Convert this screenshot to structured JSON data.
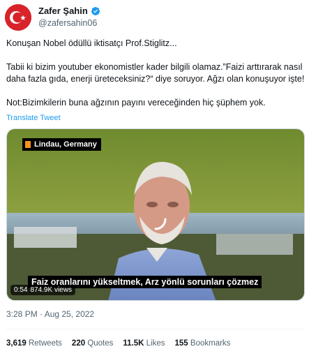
{
  "author": {
    "display_name": "Zafer Şahin",
    "handle": "@zafersahin06",
    "avatar_icon": "turkish-flag-avatar",
    "avatar_color": "#d8232a",
    "verified_icon": "verified-badge-icon",
    "verified_color": "#1d9bf0"
  },
  "tweet": {
    "paragraph_1": "Konuşan Nobel ödüllü iktisatçı Prof.Stiglitz...",
    "paragraph_2": "Tabii ki bizim youtuber ekonomistler kader bilgili olamaz.”Faizi arttırarak nasıl daha fazla gıda, enerji üreteceksiniz?“ diye soruyor. Ağzı olan konuşuyor işte!",
    "paragraph_3": "Not:Bizimkilerin buna ağzının payını vereceğinden hiç şüphem yok.",
    "translate_link": "Translate Tweet"
  },
  "video": {
    "location_label": "Lindau, Germany",
    "location_marker_color": "#f7941d",
    "subtitle": "Faiz oranlarını yükseltmek, Arz yönlü sorunları çözmez",
    "duration": "0:54",
    "views": "874.9K views",
    "loading_icon": "loading-spinner-icon"
  },
  "meta": {
    "timestamp": "3:28 PM · Aug 25, 2022"
  },
  "stats": {
    "retweets_count": "3,619",
    "retweets_label": "Retweets",
    "quotes_count": "220",
    "quotes_label": "Quotes",
    "likes_count": "11.5K",
    "likes_label": "Likes",
    "bookmarks_count": "155",
    "bookmarks_label": "Bookmarks"
  }
}
